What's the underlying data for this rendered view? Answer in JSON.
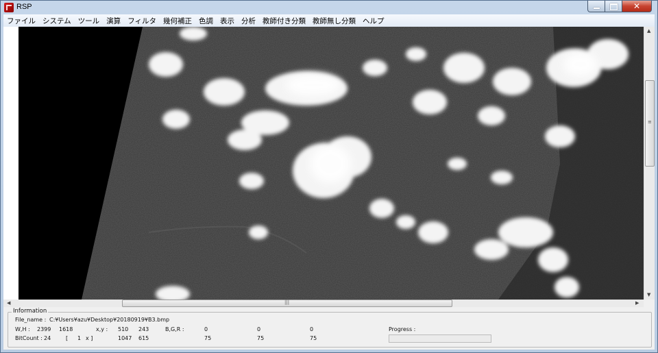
{
  "window": {
    "title": "RSP"
  },
  "menu": [
    "ファイル",
    "システム",
    "ツール",
    "演算",
    "フィルタ",
    "幾何補正",
    "色調",
    "表示",
    "分析",
    "教師付き分類",
    "教師無し分類",
    "ヘルプ"
  ],
  "info": {
    "legend": "Information",
    "file_name_label": "File_name :",
    "file_name": "C:¥Users¥azu¥Desktop¥20180919¥B3.bmp",
    "wh_label": "W,H :",
    "w": "2399",
    "h": "1618",
    "xy_label": "x,y :",
    "x": "510",
    "y": "243",
    "bgr_label": "B,G,R :",
    "b": "0",
    "g": "0",
    "r": "0",
    "bitcount_label": "BitCount :",
    "bitcount": "24",
    "zoom_open": "[",
    "zoom_value": "1",
    "zoom_close": "x ]",
    "x2": "1047",
    "y2": "615",
    "b2": "75",
    "g2": "75",
    "r2": "75",
    "progress_label": "Progress :",
    "progress": 0
  },
  "colors": {
    "title_bar": "#c5d6ea",
    "close_button": "#c74330",
    "image_ground": "#3a3a3a",
    "no_data": "#000000",
    "cloud": "#f4f4f4"
  },
  "icons": {
    "app": "rsp-app-icon",
    "minimize": "minimize-icon",
    "maximize": "maximize-icon",
    "close": "close-icon"
  }
}
